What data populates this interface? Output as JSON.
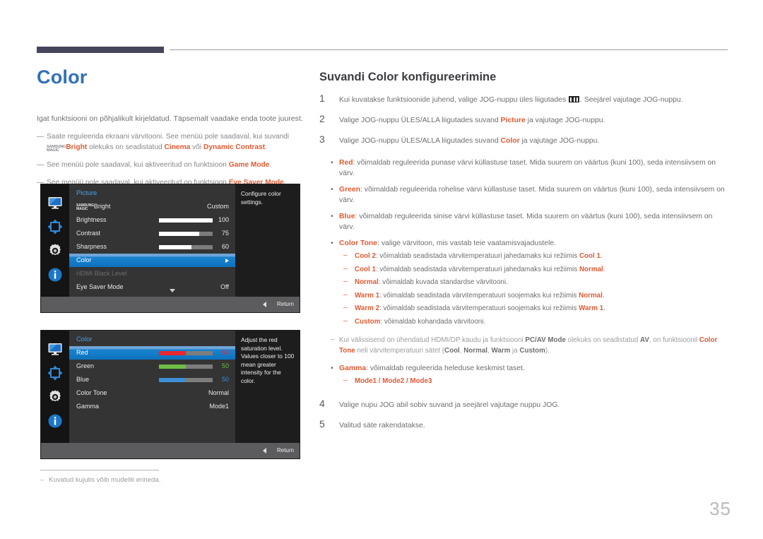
{
  "page": {
    "title": "Color",
    "number": "35"
  },
  "left": {
    "intro": "Igat funktsiooni on põhjalikult kirjeldatud. Täpsemalt vaadake enda toote juurest.",
    "notes": [
      {
        "prefix": "Saate reguleerida ekraani värvitooni. See menüü pole saadaval, kui suvandi ",
        "magic_top": "SAMSUNG",
        "magic_bottom": "MAGIC",
        "magic_suffix": "Bright",
        "middle": " olekuks on seadistatud ",
        "hl1": "Cinema",
        "conj": " või ",
        "hl2": "Dynamic Contrast",
        "end": "."
      },
      {
        "text_before": "See menüü pole saadaval, kui aktiveeritud on funktsioon ",
        "highlight": "Game Mode",
        "text_after": "."
      },
      {
        "text_before": "See menüü pole saadaval, kui aktiveeritud on funktsioon ",
        "highlight": "Eye Saver Mode",
        "text_after": "."
      }
    ],
    "bottom_note": {
      "dash": "–",
      "text": "Kuvatud kujutis võib mudeliti erineda."
    }
  },
  "osd_picture": {
    "header": "Picture",
    "help_text": "Configure color settings.",
    "footer_label": "Return",
    "rows": [
      {
        "label_magic_top": "SAMSUNG",
        "label_magic_bottom": "MAGIC",
        "label": "Bright",
        "value": "Custom",
        "bar": null,
        "state": "normal"
      },
      {
        "label": "Brightness",
        "value": "100",
        "bar": 100,
        "state": "normal"
      },
      {
        "label": "Contrast",
        "value": "75",
        "bar": 75,
        "state": "normal"
      },
      {
        "label": "Sharpness",
        "value": "60",
        "bar": 60,
        "state": "normal"
      },
      {
        "label": "Color",
        "value": "",
        "bar": null,
        "state": "selected"
      },
      {
        "label": "HDMI Black Level",
        "value": "",
        "bar": null,
        "state": "disabled"
      },
      {
        "label": "Eye Saver Mode",
        "value": "Off",
        "bar": null,
        "state": "normal"
      }
    ]
  },
  "osd_color": {
    "header": "Color",
    "help_text": "Adjust the red saturation level. Values closer to 100 mean greater intensity for the color.",
    "footer_label": "Return",
    "rows": [
      {
        "label": "Red",
        "value": "50",
        "bar": 50,
        "bar_color": "#e8262f",
        "value_color": "#e8262f",
        "state": "selected"
      },
      {
        "label": "Green",
        "value": "50",
        "bar": 50,
        "bar_color": "#6dbe45",
        "value_color": "#6dbe45",
        "state": "normal"
      },
      {
        "label": "Blue",
        "value": "50",
        "bar": 50,
        "bar_color": "#3d8fd6",
        "value_color": "#3d8fd6",
        "state": "normal"
      },
      {
        "label": "Color Tone",
        "value": "Normal",
        "bar": null,
        "state": "normal"
      },
      {
        "label": "Gamma",
        "value": "Mode1",
        "bar": null,
        "state": "normal"
      }
    ]
  },
  "right": {
    "section_title": "Suvandi Color konfigureerimine",
    "steps": [
      {
        "num": "1",
        "part1": "Kui kuvatakse funktsioonide juhend, valige JOG-nuppu üles liigutades ",
        "icon": "menu-bars-icon",
        "part2": ". Seejärel vajutage JOG-nuppu."
      },
      {
        "num": "2",
        "part1": "Valige JOG-nuppu ÜLES/ALLA liigutades suvand ",
        "highlight": "Picture",
        "part2": " ja vajutage JOG-nuppu."
      },
      {
        "num": "3",
        "part1": "Valige JOG-nuppu ÜLES/ALLA liigutades suvand ",
        "highlight": "Color",
        "part2": " ja vajutage JOG-nuppu."
      }
    ],
    "bullets": [
      {
        "term": "Red",
        "text": ": võimaldab reguleerida punase värvi küllastuse taset. Mida suurem on väärtus (kuni 100), seda intensiivsem on värv."
      },
      {
        "term": "Green",
        "text": ": võimaldab reguleerida rohelise värvi küllastuse taset. Mida suurem on väärtus (kuni 100), seda intensiivsem on värv."
      },
      {
        "term": "Blue",
        "text": ": võimaldab reguleerida sinise värvi küllastuse taset. Mida suurem on väärtus (kuni 100), seda intensiivsem on värv."
      }
    ],
    "color_tone": {
      "term": "Color Tone",
      "text": ": valige värvitoon, mis vastab teie vaatamisvajadustele.",
      "subs": [
        {
          "term": "Cool 2",
          "mid": ": võimaldab seadistada värvitemperatuuri jahedamaks kui režiimis ",
          "ref": "Cool 1",
          "end": "."
        },
        {
          "term": "Cool 1",
          "mid": ": võimaldab seadistada värvitemperatuuri jahedamaks kui režiimis ",
          "ref": "Normal",
          "end": "."
        },
        {
          "term": "Normal",
          "mid": ": võimaldab kuvada standardse värvitooni.",
          "ref": "",
          "end": ""
        },
        {
          "term": "Warm 1",
          "mid": ": võimaldab seadistada värvitemperatuuri soojemaks kui režiimis ",
          "ref": "Normal",
          "end": "."
        },
        {
          "term": "Warm 2",
          "mid": ": võimaldab seadistada värvitemperatuuri soojemaks kui režiimis ",
          "ref": "Warm 1",
          "end": "."
        },
        {
          "term": "Custom",
          "mid": ": võimaldab kohandada värvitooni.",
          "ref": "",
          "end": ""
        }
      ]
    },
    "hdmi_note": {
      "dash": "–",
      "p1": "Kui välissisend on ühendatud HDMI/DP kaudu ja funktsiooni ",
      "b1": "PC/AV Mode",
      "p2": " olekuks on seadistatud ",
      "b2": "AV",
      "p3": ", on funktsioonil ",
      "b3": "Color Tone",
      "p4": " neli värvitemperatuuri sätet (",
      "b4": "Cool",
      "p5": ", ",
      "b5": "Normal",
      "p6": ", ",
      "b6": "Warm",
      "p7": " ja ",
      "b7": "Custom",
      "p8": ")."
    },
    "gamma": {
      "term": "Gamma",
      "text": ": võimaldab reguleerida heleduse keskmist taset.",
      "sub_dash": "–",
      "sub_modes": "Mode1 / Mode2 / Mode3"
    },
    "steps_end": [
      {
        "num": "4",
        "text": "Valige nupu JOG abil sobiv suvand ja seejärel vajutage nuppu JOG."
      },
      {
        "num": "5",
        "text": "Valitud säte rakendatakse."
      }
    ]
  }
}
